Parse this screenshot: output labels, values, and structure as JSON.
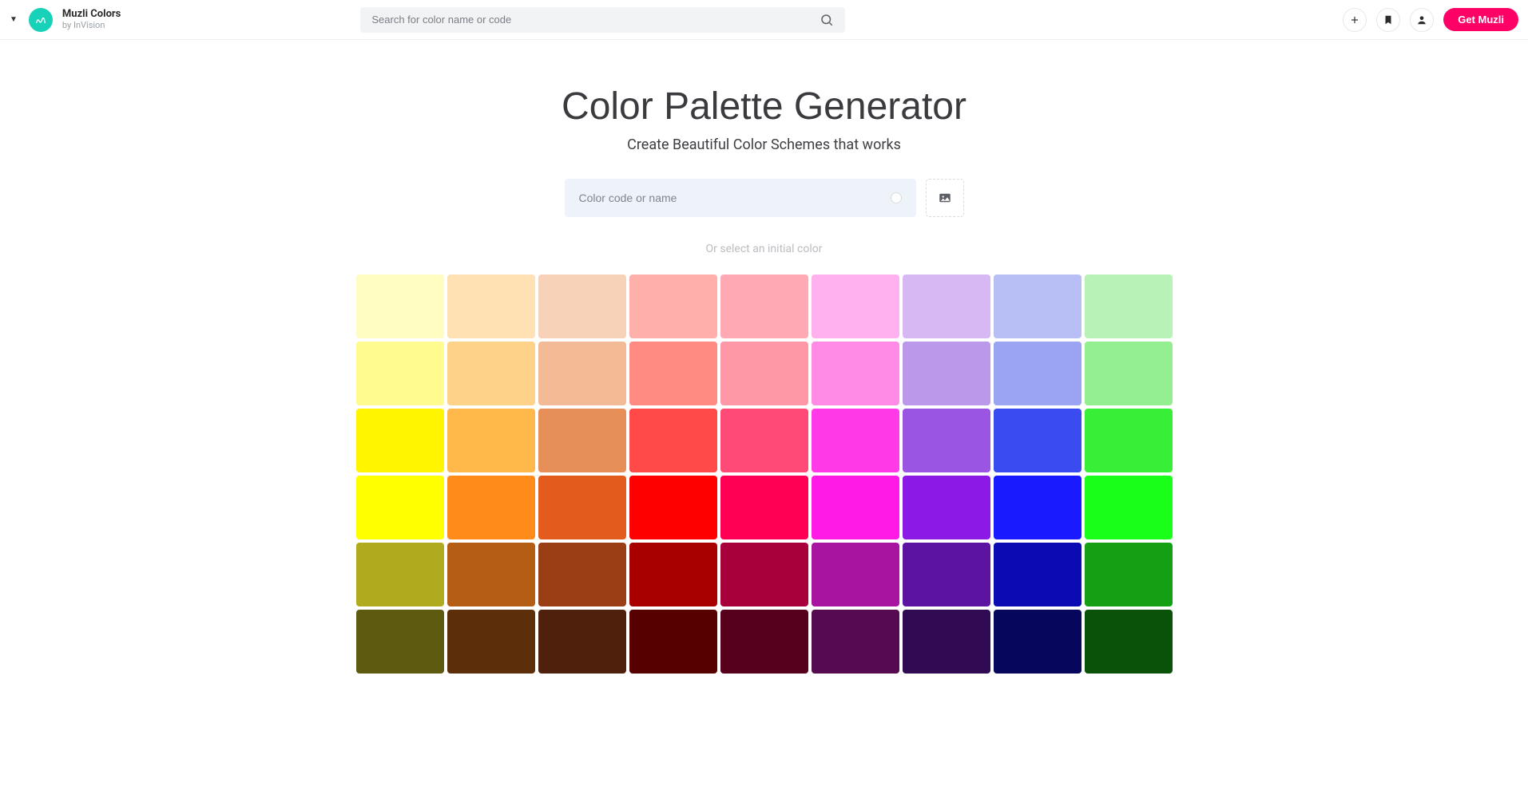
{
  "header": {
    "brand_name": "Muzli Colors",
    "brand_sub": "by InVision",
    "search_placeholder": "Search for color name or code",
    "get_muzli_label": "Get Muzli"
  },
  "main": {
    "title": "Color Palette Generator",
    "subtitle": "Create Beautiful Color Schemes that works",
    "color_input_placeholder": "Color code or name",
    "hint": "Or select an initial color"
  },
  "grid": {
    "colors": [
      [
        "#fffdc1",
        "#ffe1b3",
        "#f7d1b8",
        "#ffb0ab",
        "#ffa9b4",
        "#ffb0ef",
        "#d7b8f3",
        "#b8bff5",
        "#b9f2b7"
      ],
      [
        "#fffb8f",
        "#ffd28a",
        "#f2bb96",
        "#ff8b83",
        "#ff98a6",
        "#ff8be6",
        "#bb98ea",
        "#9aa4f1",
        "#93ef90"
      ],
      [
        "#fff500",
        "#ffb84a",
        "#e78f59",
        "#ff4a49",
        "#ff4a77",
        "#ff3ae6",
        "#9a56e3",
        "#3a4cef",
        "#38ef38"
      ],
      [
        "#ffff00",
        "#ff8c1a",
        "#e35c1e",
        "#ff0000",
        "#ff0055",
        "#ff1ae6",
        "#8c1ae6",
        "#1a1aff",
        "#1aff1a"
      ],
      [
        "#b0aa1f",
        "#b35e14",
        "#9a3e15",
        "#a80000",
        "#a8003a",
        "#a814a0",
        "#5c14a0",
        "#0b0bb3",
        "#14a014"
      ],
      [
        "#5e5a10",
        "#5c2f0a",
        "#4f200b",
        "#560000",
        "#56001e",
        "#560a52",
        "#300a52",
        "#06065c",
        "#0a520a"
      ]
    ]
  }
}
